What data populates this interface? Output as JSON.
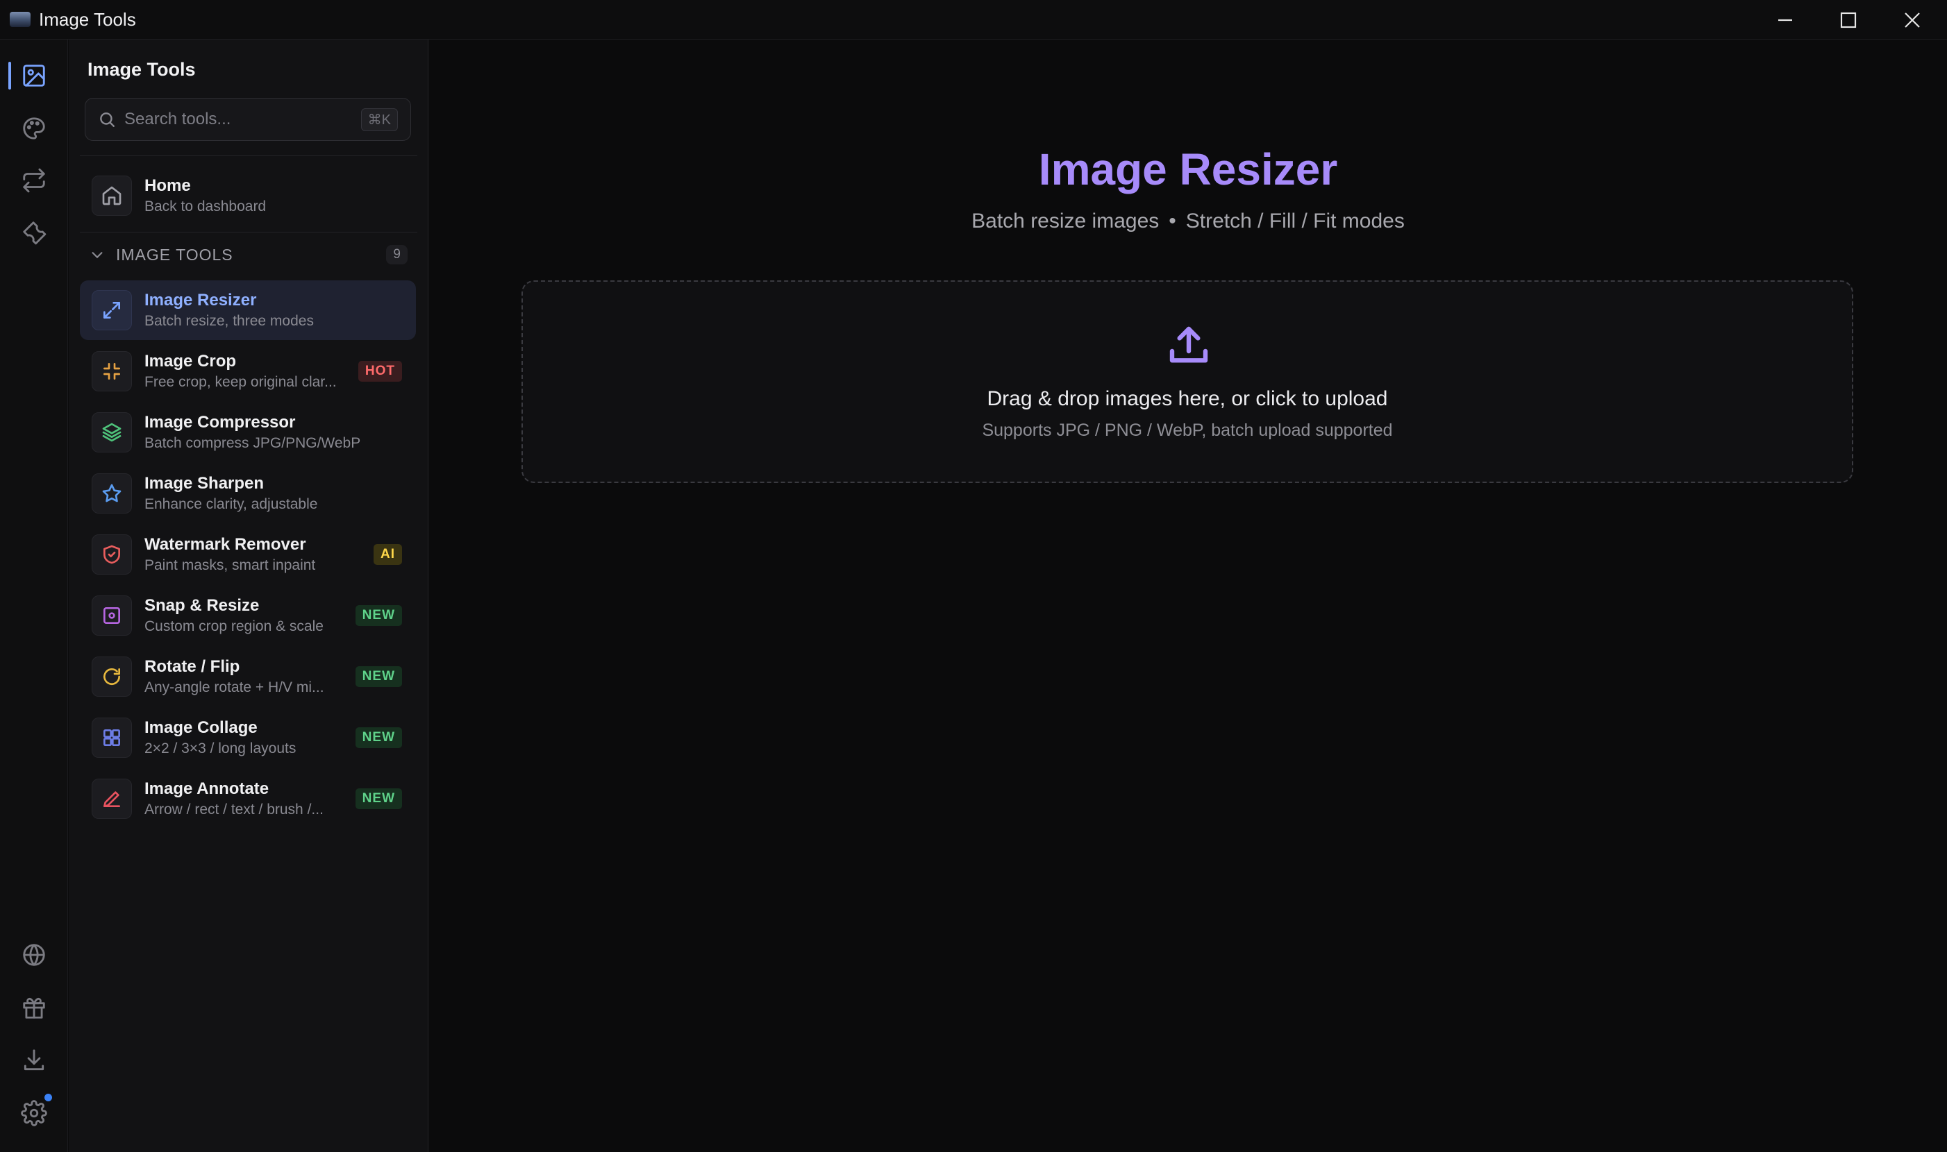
{
  "window": {
    "title": "Image Tools"
  },
  "sidebar": {
    "title": "Image Tools",
    "search": {
      "placeholder": "Search tools...",
      "shortcut": "⌘K"
    },
    "home": {
      "name": "Home",
      "desc": "Back to dashboard"
    },
    "group": {
      "label": "IMAGE TOOLS",
      "count": "9"
    },
    "items": [
      {
        "name": "Image Resizer",
        "desc": "Batch resize, three modes",
        "badge": ""
      },
      {
        "name": "Image Crop",
        "desc": "Free crop, keep original clar...",
        "badge": "HOT"
      },
      {
        "name": "Image Compressor",
        "desc": "Batch compress JPG/PNG/WebP",
        "badge": ""
      },
      {
        "name": "Image Sharpen",
        "desc": "Enhance clarity, adjustable",
        "badge": ""
      },
      {
        "name": "Watermark Remover",
        "desc": "Paint masks, smart inpaint",
        "badge": "AI"
      },
      {
        "name": "Snap & Resize",
        "desc": "Custom crop region & scale",
        "badge": "NEW"
      },
      {
        "name": "Rotate / Flip",
        "desc": "Any-angle rotate + H/V mi...",
        "badge": "NEW"
      },
      {
        "name": "Image Collage",
        "desc": "2×2 / 3×3 / long layouts",
        "badge": "NEW"
      },
      {
        "name": "Image Annotate",
        "desc": "Arrow / rect / text / brush /...",
        "badge": "NEW"
      }
    ]
  },
  "main": {
    "title": "Image Resizer",
    "subtitle_a": "Batch resize images",
    "subtitle_sep": "•",
    "subtitle_b": "Stretch / Fill / Fit modes",
    "dropzone": {
      "title": "Drag & drop images here, or click to upload",
      "subtitle": "Supports JPG / PNG / WebP, batch upload supported"
    }
  },
  "colors": {
    "accent": "#a78bfa",
    "active_blue": "#7aa4ff",
    "hot": "#ff6b6b",
    "new": "#5fd28a",
    "ai": "#ffd84a"
  }
}
